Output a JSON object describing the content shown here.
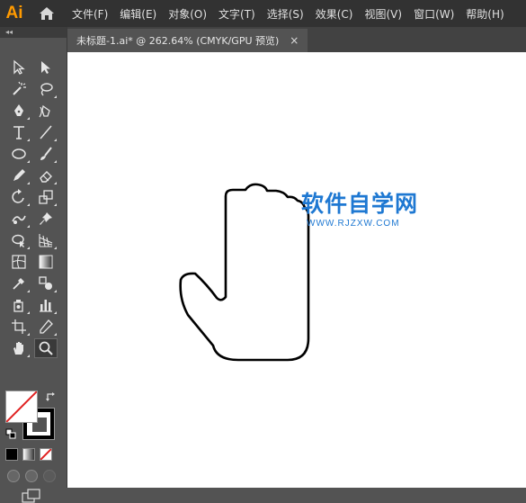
{
  "app": {
    "logo_text": "Ai",
    "accent": "#FF9A00"
  },
  "menubar": {
    "home_icon": "home-icon",
    "items": [
      "文件(F)",
      "编辑(E)",
      "对象(O)",
      "文字(T)",
      "选择(S)",
      "效果(C)",
      "视图(V)",
      "窗口(W)",
      "帮助(H)"
    ]
  },
  "toolbar": {
    "collapse_label": "◂◂",
    "tools": [
      "selection-tool",
      "direct-selection-tool",
      "magic-wand-tool",
      "lasso-tool",
      "pen-tool",
      "curvature-tool",
      "type-tool",
      "line-segment-tool",
      "ellipse-tool",
      "paintbrush-tool",
      "shaper-tool",
      "eraser-tool",
      "rotate-tool",
      "scale-tool",
      "puppet-warp-tool",
      "pin-tool",
      "shape-builder-tool",
      "perspective-grid-tool",
      "mesh-tool",
      "gradient-tool",
      "eyedropper-tool",
      "blend-tool",
      "symbol-sprayer-tool",
      "column-graph-tool",
      "artboard-tool",
      "slice-tool",
      "hand-tool",
      "zoom-tool"
    ],
    "active_tool": "zoom-tool",
    "fill_color": "none",
    "stroke_color": "#000000"
  },
  "document": {
    "tab_title": "未标题-1.ai* @ 262.64% (CMYK/GPU 预览)",
    "close_label": "×"
  },
  "watermark": {
    "title": "软件自学网",
    "url": "WWW.RJZXW.COM",
    "color": "#1E78D2"
  }
}
